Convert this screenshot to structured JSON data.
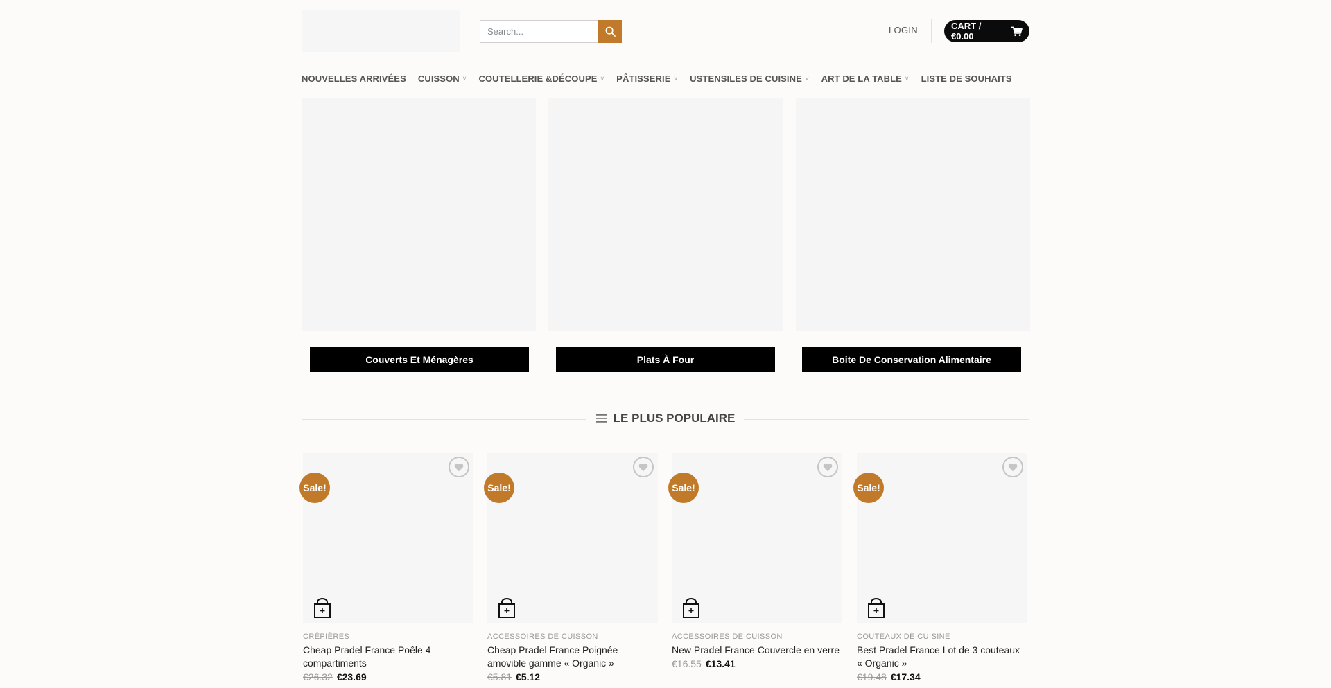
{
  "header": {
    "search_placeholder": "Search...",
    "login_label": "LOGIN",
    "cart_label": "CART / €0.00"
  },
  "nav": {
    "items": [
      {
        "label": "NOUVELLES ARRIVÉES",
        "has_dropdown": false
      },
      {
        "label": "CUISSON",
        "has_dropdown": true
      },
      {
        "label": "COUTELLERIE &DÉCOUPE",
        "has_dropdown": true
      },
      {
        "label": "PÂTISSERIE",
        "has_dropdown": true
      },
      {
        "label": "USTENSILES DE CUISINE",
        "has_dropdown": true
      },
      {
        "label": "ART DE LA TABLE",
        "has_dropdown": true
      },
      {
        "label": "LISTE DE SOUHAITS",
        "has_dropdown": false
      }
    ]
  },
  "categories": [
    {
      "label": "Couverts Et Ménagères"
    },
    {
      "label": "Plats À Four"
    },
    {
      "label": "Boite De Conservation Alimentaire"
    }
  ],
  "section": {
    "title": "LE PLUS POPULAIRE"
  },
  "products": [
    {
      "badge": "Sale!",
      "category": "CRÊPIÈRES",
      "name": "Cheap Pradel France Poêle 4 compartiments",
      "old_price": "€26.32",
      "price": "€23.69"
    },
    {
      "badge": "Sale!",
      "category": "ACCESSOIRES DE CUISSON",
      "name": "Cheap Pradel France Poignée amovible gamme « Organic »",
      "old_price": "€5.81",
      "price": "€5.12"
    },
    {
      "badge": "Sale!",
      "category": "ACCESSOIRES DE CUISSON",
      "name": "New Pradel France Couvercle en verre",
      "old_price": "€16.55",
      "price": "€13.41"
    },
    {
      "badge": "Sale!",
      "category": "COUTEAUX DE CUISINE",
      "name": "Best Pradel France Lot de 3 couteaux « Organic »",
      "old_price": "€19.48",
      "price": "€17.34"
    }
  ],
  "colors": {
    "accent": "#c07a2a",
    "dark": "#0b0b0b"
  }
}
